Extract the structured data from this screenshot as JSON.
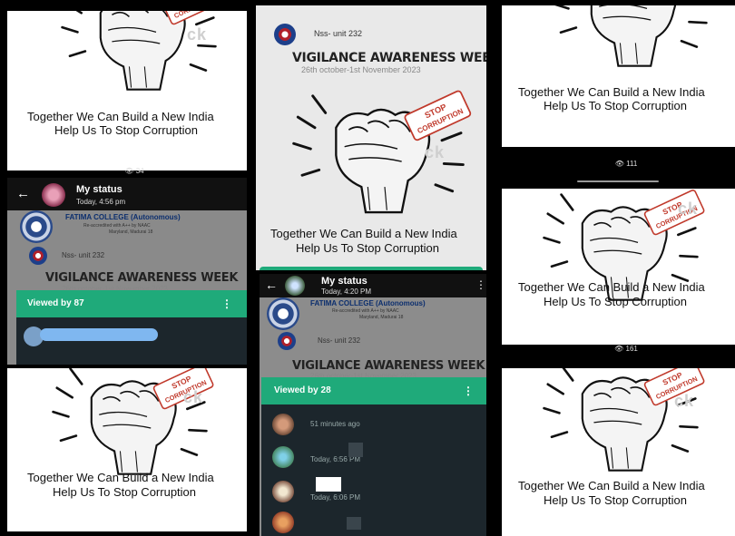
{
  "poster": {
    "line1": "Together We  Can Build a New India",
    "line2": "Help Us To Stop Corruption",
    "watermark": "ck",
    "banner": "STOP\nCORRUPTION"
  },
  "views": {
    "panel1": "34",
    "panel_r1": "111",
    "panel_r2": "161"
  },
  "status1": {
    "title": "My status",
    "time": "Today, 4:56 pm",
    "college": "FATIMA COLLEGE (Autonomous)",
    "naac": "Re-accredited with A++ by NAAC",
    "address": "Maryland, Madurai 18",
    "nss": "Nss- unit 232",
    "event": "VIGILANCE AWARENESS WEEK",
    "event_date": "26th october-1st November 2023",
    "viewed": "Viewed by 87",
    "menu": "⋮"
  },
  "center_top": {
    "nss": "Nss- unit 232",
    "event": "VIGILANCE AWARENESS WEEK",
    "event_date": "26th october-1st November 2023"
  },
  "status2": {
    "title": "My status",
    "time": "Today, 4:20 PM",
    "college": "FATIMA COLLEGE (Autonomous)",
    "naac": "Re-accredited with A++ by NAAC",
    "address": "Maryland, Madurai 18",
    "nss": "Nss- unit 232",
    "event": "VIGILANCE AWARENESS WEEK",
    "event_date": "26th october-1st November 2023",
    "viewed": "Viewed by 28",
    "menu": "⋮",
    "viewers": [
      {
        "time": "51 minutes ago"
      },
      {
        "time": "Today, 6:56 PM"
      },
      {
        "time": "Today, 6:06 PM"
      },
      {
        "time": ""
      }
    ]
  },
  "colors": {
    "whatsapp_green": "#1faa7a",
    "viewer_bg": "#1c262c",
    "red_banner": "#c0392b"
  }
}
